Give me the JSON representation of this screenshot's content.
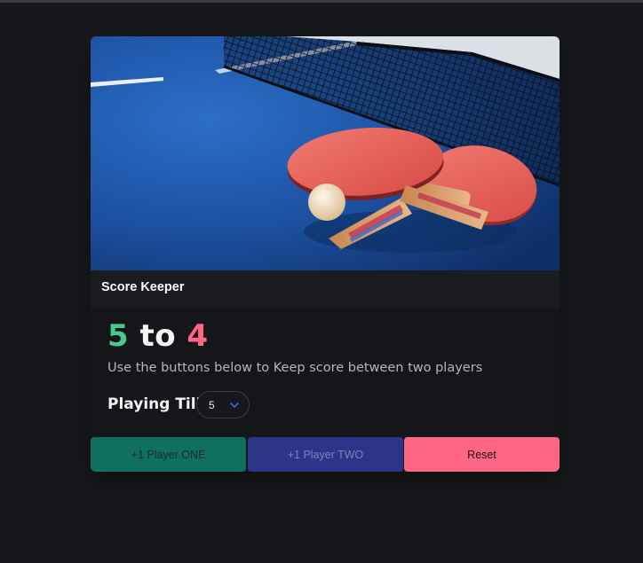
{
  "card": {
    "title": "Score Keeper",
    "hero_image": "ping-pong-paddles-and-ball-on-table"
  },
  "score": {
    "player_one": "5",
    "separator": "to",
    "player_two": "4"
  },
  "subtitle": "Use the buttons below to Keep score between two players",
  "playing_till": {
    "label": "Playing Till",
    "selected": "5"
  },
  "buttons": {
    "player_one": "+1 Player ONE",
    "player_two": "+1 Player TWO",
    "reset": "Reset"
  },
  "colors": {
    "player_one": "#48c78e",
    "player_two": "#ff6685",
    "btn_one_bg": "#0f7062",
    "btn_two_bg": "#2d3589",
    "reset_bg": "#ff6685"
  }
}
